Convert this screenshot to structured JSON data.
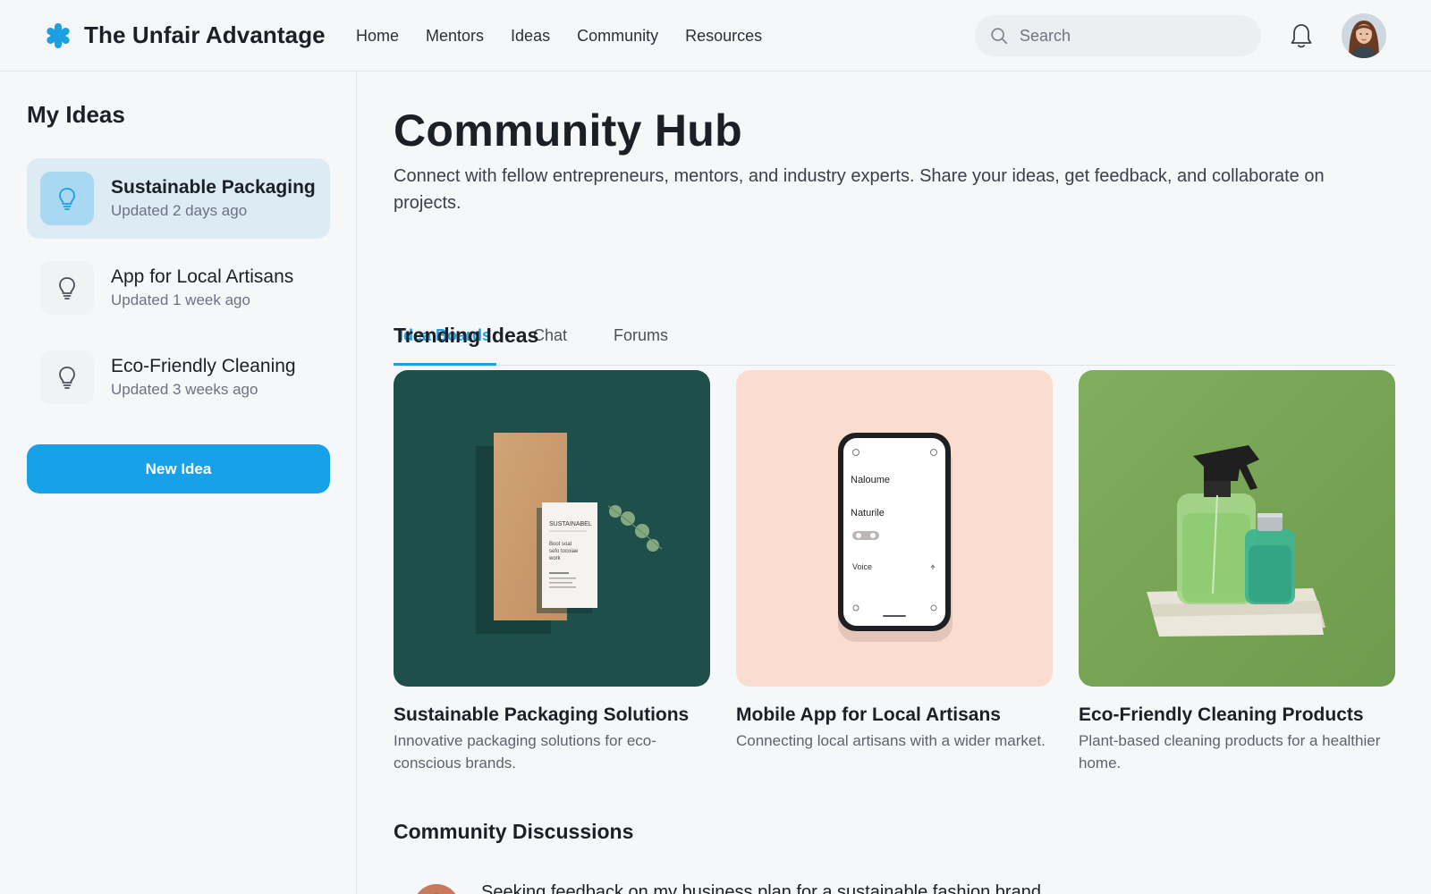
{
  "header": {
    "brand_name": "The Unfair Advantage",
    "brand_icon": "asterisk-logo-icon",
    "nav": [
      "Home",
      "Mentors",
      "Ideas",
      "Community",
      "Resources"
    ],
    "search_placeholder": "Search",
    "icons": [
      "search-icon",
      "bell-icon",
      "avatar"
    ]
  },
  "sidebar": {
    "title": "My Ideas",
    "items": [
      {
        "title": "Sustainable Packaging",
        "updated": "Updated 2 days ago",
        "active": true
      },
      {
        "title": "App for Local Artisans",
        "updated": "Updated 1 week ago",
        "active": false
      },
      {
        "title": "Eco-Friendly Cleaning",
        "updated": "Updated 3 weeks ago",
        "active": false
      }
    ],
    "new_idea_label": "New Idea"
  },
  "main": {
    "title": "Community Hub",
    "description": "Connect with fellow entrepreneurs, mentors, and industry experts. Share your ideas, get feedback, and collaborate on projects.",
    "tabs": [
      {
        "label": "Idea Boards",
        "active": true
      },
      {
        "label": "Chat",
        "active": false
      },
      {
        "label": "Forums",
        "active": false
      }
    ],
    "trending_title": "Trending Ideas",
    "cards": [
      {
        "title": "Sustainable Packaging Solutions",
        "description": "Innovative packaging solutions for eco-conscious brands.",
        "mock_label_1": "SUSTAINABEL",
        "mock_label_2": "Boot soal sefo tocoiae work"
      },
      {
        "title": "Mobile App for Local Artisans",
        "description": "Connecting local artisans with a wider market.",
        "phone_line_1": "Naloume",
        "phone_line_2": "Naturile",
        "phone_line_3": "Voice"
      },
      {
        "title": "Eco-Friendly Cleaning Products",
        "description": "Plant-based cleaning products for a healthier home."
      }
    ],
    "discussions_title": "Community Discussions",
    "discussions": [
      {
        "text": "Seeking feedback on my business plan for a sustainable fashion brand"
      }
    ]
  },
  "colors": {
    "accent": "#17a2e8",
    "active_item_bg": "#dcebf4",
    "card1_bg": "#1e4f4b",
    "card2_bg": "#fbdcd1",
    "card3_bg": "#7ea75a"
  }
}
